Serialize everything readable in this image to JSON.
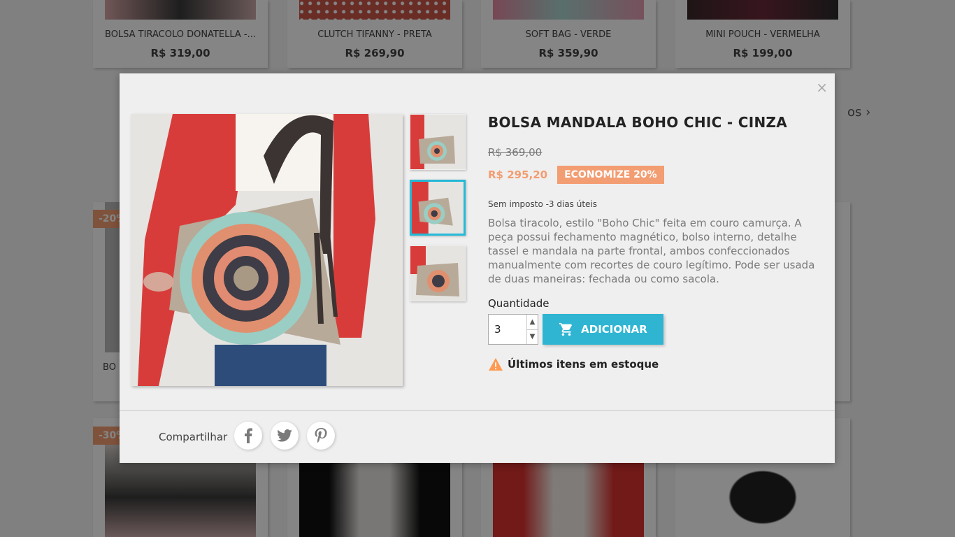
{
  "background": {
    "row1": [
      {
        "name": "BOLSA TIRACOLO DONATELLA -...",
        "price": "R$ 319,00"
      },
      {
        "name": "CLUTCH TIFANNY - PRETA",
        "price": "R$ 269,90"
      },
      {
        "name": "SOFT BAG - VERDE",
        "price": "R$ 359,90"
      },
      {
        "name": "MINI POUCH - VERMELHA",
        "price": "R$ 199,00"
      }
    ],
    "badge_row2": "-20%",
    "partial_name_row2": "BO",
    "badge_row3": "-30%",
    "nav_partial": "os"
  },
  "modal": {
    "close_label": "×",
    "title": "BOLSA MANDALA BOHO CHIC - CINZA",
    "old_price": "R$ 369,00",
    "new_price": "R$ 295,20",
    "discount_label": "ECONOMIZE 20%",
    "tax_info": "Sem imposto  -3 dias úteis",
    "description": "Bolsa tiracolo, estilo \"Boho Chic\" feita em couro camurça. A peça possui fechamento magnético, bolso interno, detalhe tassel e mandala na parte frontal, ambos confeccionados manualmente com recortes de couro legítimo. Pode ser usada de duas maneiras: fechada ou como sacola.",
    "quantity_label": "Quantidade",
    "quantity_value": "3",
    "add_button": "ADICIONAR",
    "stock_notice": "Últimos itens em estoque",
    "share_label": "Compartilhar",
    "colors": {
      "accent": "#2fb5d2",
      "discount": "#f39d72",
      "warning": "#ff9a52"
    }
  }
}
